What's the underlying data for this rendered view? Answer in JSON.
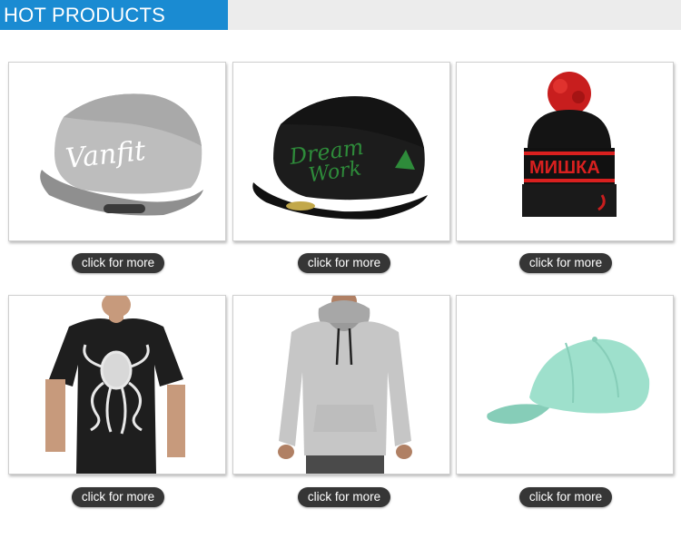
{
  "header": {
    "title": "HOT PRODUCTS"
  },
  "products": [
    {
      "icon": "gray-snapback-cap-icon",
      "button_label": "click for more"
    },
    {
      "icon": "black-snapback-cap-icon",
      "button_label": "click for more"
    },
    {
      "icon": "pom-pom-beanie-icon",
      "button_label": "click for more"
    },
    {
      "icon": "black-tshirt-icon",
      "button_label": "click for more"
    },
    {
      "icon": "gray-hoodie-icon",
      "button_label": "click for more"
    },
    {
      "icon": "mint-baseball-cap-icon",
      "button_label": "click for more"
    }
  ],
  "colors": {
    "accent": "#1a8bd2",
    "button": "#363636",
    "header_band": "#ececec"
  }
}
